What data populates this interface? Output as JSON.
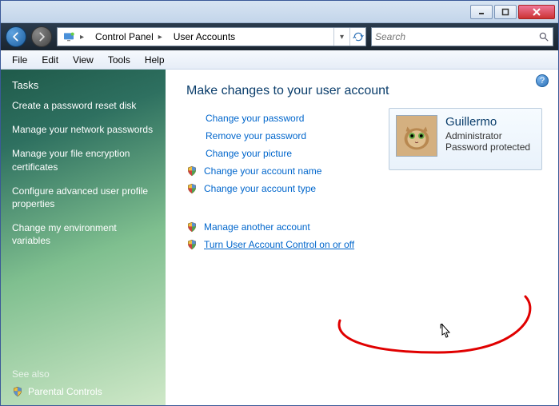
{
  "titlebar": {
    "min": "_",
    "max": "□",
    "close": "✕"
  },
  "nav": {
    "breadcrumb": [
      "Control Panel",
      "User Accounts"
    ],
    "search_placeholder": "Search"
  },
  "menu": [
    "File",
    "Edit",
    "View",
    "Tools",
    "Help"
  ],
  "sidebar": {
    "title": "Tasks",
    "links": [
      "Create a password reset disk",
      "Manage your network passwords",
      "Manage your file encryption certificates",
      "Configure advanced user profile properties",
      "Change my environment variables"
    ],
    "seealso": "See also",
    "parental": "Parental Controls"
  },
  "main": {
    "heading": "Make changes to your user account",
    "links1": [
      {
        "label": "Change your password",
        "shield": false
      },
      {
        "label": "Remove your password",
        "shield": false
      },
      {
        "label": "Change your picture",
        "shield": false
      },
      {
        "label": "Change your account name",
        "shield": true
      },
      {
        "label": "Change your account type",
        "shield": true
      }
    ],
    "links2": [
      {
        "label": "Manage another account",
        "shield": true
      },
      {
        "label": "Turn User Account Control on or off",
        "shield": true,
        "highlight": true
      }
    ]
  },
  "user": {
    "name": "Guillermo",
    "role": "Administrator",
    "status": "Password protected"
  }
}
